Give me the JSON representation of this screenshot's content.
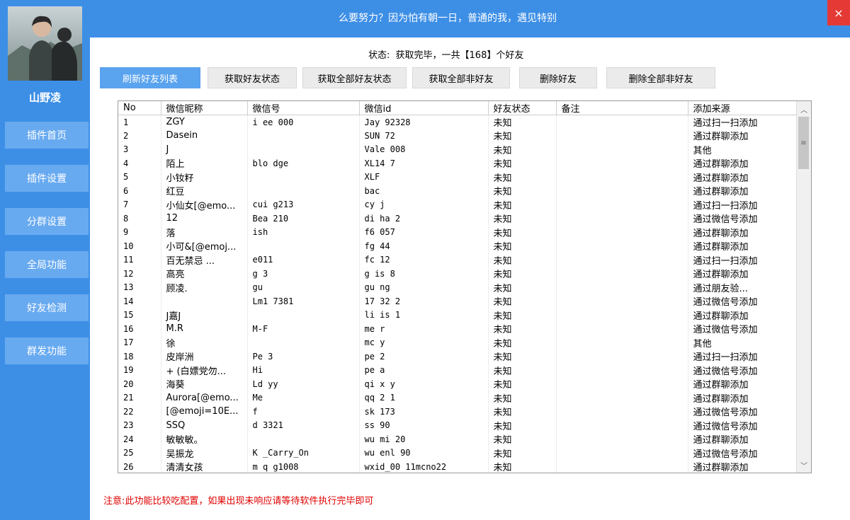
{
  "user": {
    "name": "山野凌"
  },
  "nav": [
    {
      "label": "插件首页"
    },
    {
      "label": "插件设置"
    },
    {
      "label": "分群设置"
    },
    {
      "label": "全局功能"
    },
    {
      "label": "好友检测"
    },
    {
      "label": "群发功能"
    }
  ],
  "header": {
    "title": "么要努力？因为怕有朝一日，普通的我，遇见特别",
    "close_label": "×"
  },
  "status": {
    "label": "状态:",
    "text": "获取完毕，一共【168】个好友"
  },
  "toolbar": {
    "buttons": [
      {
        "label": "刷新好友列表",
        "active": true
      },
      {
        "label": "获取好友状态"
      },
      {
        "label": "获取全部好友状态"
      },
      {
        "label": "获取全部非好友"
      },
      {
        "label": "删除好友"
      },
      {
        "label": "删除全部非好友"
      }
    ]
  },
  "table": {
    "columns": [
      "No",
      "微信昵称",
      "微信号",
      "微信id",
      "好友状态",
      "备注",
      "添加来源"
    ],
    "rows": [
      {
        "no": "1",
        "nick": "ZGY",
        "wxno": "i  ee   000",
        "wxid": "Jay  92328",
        "status": "未知",
        "remark": "",
        "source": "通过扫一扫添加"
      },
      {
        "no": "2",
        "nick": "Dasein",
        "wxno": "",
        "wxid": "SUN    72",
        "status": "未知",
        "remark": "",
        "source": "通过群聊添加"
      },
      {
        "no": "3",
        "nick": "J",
        "wxno": "",
        "wxid": "Vale    008",
        "status": "未知",
        "remark": "",
        "source": "其他"
      },
      {
        "no": "4",
        "nick": "陌上",
        "wxno": "blo    dge",
        "wxid": "XL14   7",
        "status": "未知",
        "remark": "",
        "source": "通过群聊添加"
      },
      {
        "no": "5",
        "nick": "小钕籽",
        "wxno": "",
        "wxid": "XLF",
        "status": "未知",
        "remark": "",
        "source": "通过群聊添加"
      },
      {
        "no": "6",
        "nick": "红豆",
        "wxno": "",
        "wxid": "bac",
        "status": "未知",
        "remark": "",
        "source": "通过群聊添加"
      },
      {
        "no": "7",
        "nick": "小仙女[@emo...",
        "wxno": "cui   g213",
        "wxid": "cy  j",
        "status": "未知",
        "remark": "",
        "source": "通过扫一扫添加"
      },
      {
        "no": "8",
        "nick": "12",
        "wxno": "Bea   210",
        "wxid": "di  ha  2",
        "status": "未知",
        "remark": "",
        "source": "通过微信号添加"
      },
      {
        "no": "9",
        "nick": "落",
        "wxno": "ish",
        "wxid": "f6 057",
        "status": "未知",
        "remark": "",
        "source": "通过群聊添加"
      },
      {
        "no": "10",
        "nick": "小可&[@emoj...",
        "wxno": "",
        "wxid": "fg 44",
        "status": "未知",
        "remark": "",
        "source": "通过群聊添加"
      },
      {
        "no": "11",
        "nick": "百无禁忌   ...",
        "wxno": "   e011",
        "wxid": "fc 12",
        "status": "未知",
        "remark": "",
        "source": "通过扫一扫添加"
      },
      {
        "no": "12",
        "nick": "高亮",
        "wxno": "g    3",
        "wxid": "g  is  8",
        "status": "未知",
        "remark": "",
        "source": "通过群聊添加"
      },
      {
        "no": "13",
        "nick": "顾凌.",
        "wxno": "gu",
        "wxid": "gu ng",
        "status": "未知",
        "remark": "",
        "source": "通过朋友验..."
      },
      {
        "no": "14",
        "nick": "",
        "wxno": "Lm1    7381",
        "wxid": "17 32  2",
        "status": "未知",
        "remark": "",
        "source": "通过微信号添加"
      },
      {
        "no": "15",
        "nick": "J嘉J",
        "wxno": "",
        "wxid": "li  is  1",
        "status": "未知",
        "remark": "",
        "source": "通过群聊添加"
      },
      {
        "no": "16",
        "nick": "M.R",
        "wxno": "M-F",
        "wxid": "me  r",
        "status": "未知",
        "remark": "",
        "source": "通过微信号添加"
      },
      {
        "no": "17",
        "nick": "徐",
        "wxno": "",
        "wxid": "mc  y",
        "status": "未知",
        "remark": "",
        "source": "其他"
      },
      {
        "no": "18",
        "nick": "皮岸洲",
        "wxno": "Pe   3",
        "wxid": "pe  2",
        "status": "未知",
        "remark": "",
        "source": "通过扫一扫添加"
      },
      {
        "no": "19",
        "nick": "+ (白嫖党勿...",
        "wxno": "Hi",
        "wxid": "pe  a",
        "status": "未知",
        "remark": "",
        "source": "通过微信号添加"
      },
      {
        "no": "20",
        "nick": "海葵",
        "wxno": "Ld    yy",
        "wxid": "qi  x   y",
        "status": "未知",
        "remark": "",
        "source": "通过群聊添加"
      },
      {
        "no": "21",
        "nick": "Aurora[@emo...",
        "wxno": "Me",
        "wxid": "qq  2  1",
        "status": "未知",
        "remark": "",
        "source": "通过群聊添加"
      },
      {
        "no": "22",
        "nick": "[@emoji=10E...",
        "wxno": "f",
        "wxid": "sk    173",
        "status": "未知",
        "remark": "",
        "source": "通过微信号添加"
      },
      {
        "no": "23",
        "nick": "SSQ",
        "wxno": "d    3321",
        "wxid": "ss  90",
        "status": "未知",
        "remark": "",
        "source": "通过微信号添加"
      },
      {
        "no": "24",
        "nick": "敏敏敏。",
        "wxno": "",
        "wxid": "wu  mi  20",
        "status": "未知",
        "remark": "",
        "source": "通过群聊添加"
      },
      {
        "no": "25",
        "nick": "吴振龙",
        "wxno": "K    _Carry_On",
        "wxid": "wu  enl   90",
        "status": "未知",
        "remark": "",
        "source": "通过微信号添加"
      },
      {
        "no": "26",
        "nick": "清清女孩",
        "wxno": "m    q  g1008",
        "wxid": "wxid_00   11mcno22",
        "status": "未知",
        "remark": "",
        "source": "通过群聊添加"
      }
    ]
  },
  "footer": {
    "note": "注意:此功能比较吃配置，如果出现未响应请等待软件执行完毕即可"
  },
  "colors": {
    "primary": "#3d8fe6",
    "nav_item": "#68aaf0",
    "close": "#e53935",
    "warning": "#e00000"
  }
}
